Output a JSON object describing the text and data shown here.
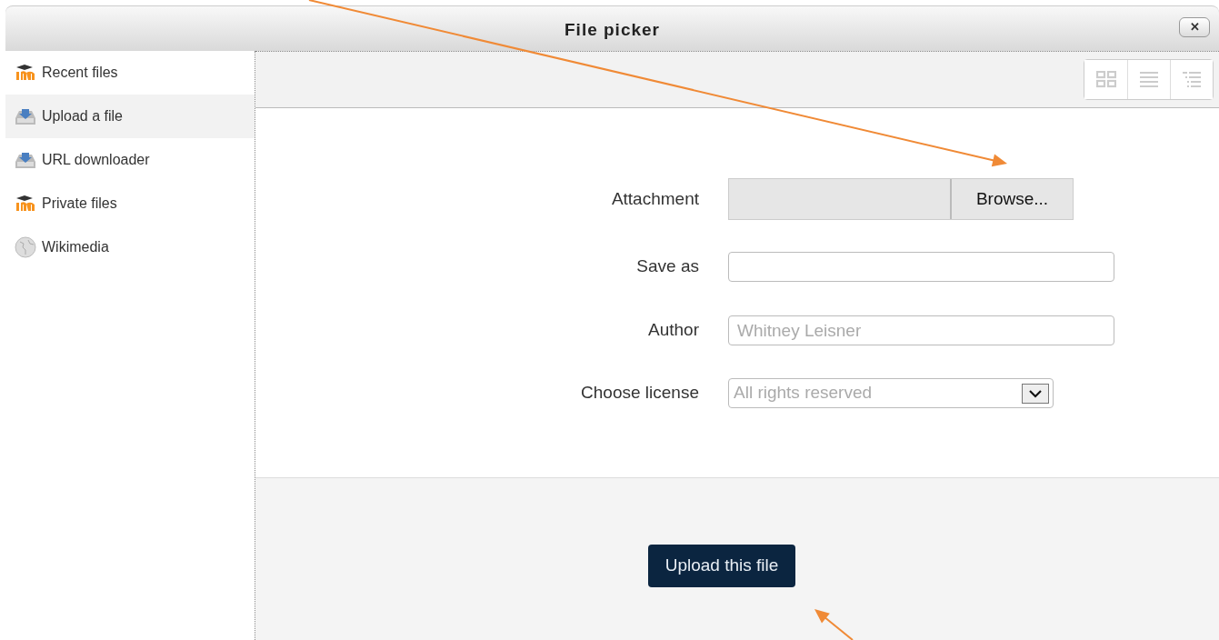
{
  "window": {
    "title": "File picker",
    "close_label": "✕"
  },
  "sidebar": {
    "items": [
      {
        "label": "Recent files",
        "kind": "cap",
        "selected": false
      },
      {
        "label": "Upload a file",
        "kind": "tray",
        "selected": true
      },
      {
        "label": "URL downloader",
        "kind": "tray",
        "selected": false
      },
      {
        "label": "Private files",
        "kind": "cap",
        "selected": false
      },
      {
        "label": "Wikimedia",
        "kind": "globe",
        "selected": false
      }
    ]
  },
  "view_buttons": [
    {
      "kind": "icons"
    },
    {
      "kind": "list"
    },
    {
      "kind": "tree"
    }
  ],
  "form": {
    "fields": [
      {
        "kind": "file",
        "label": "Attachment",
        "button": "Browse..."
      },
      {
        "kind": "text",
        "label": "Save as"
      },
      {
        "kind": "text",
        "label": "Author",
        "value": "Whitney Leisner"
      },
      {
        "kind": "select",
        "label": "Choose license",
        "value": "All rights reserved"
      }
    ]
  },
  "submit": {
    "label": "Upload this file"
  },
  "annotations": [
    {
      "kind": "arrow"
    },
    {
      "kind": "arrow"
    }
  ]
}
